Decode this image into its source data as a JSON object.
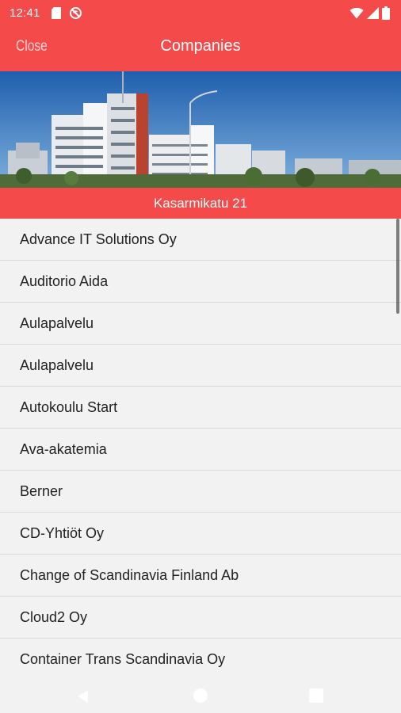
{
  "status_bar": {
    "time": "12:41",
    "icons": [
      "sd-card-icon",
      "no-sync-icon",
      "wifi-icon",
      "signal-icon",
      "battery-icon"
    ]
  },
  "app_bar": {
    "close_label": "Close",
    "title": "Companies"
  },
  "hero": {
    "image_name": "building-photo"
  },
  "address": "Kasarmikatu 21",
  "companies": [
    "Advance IT Solutions Oy",
    "Auditorio Aida",
    "Aulapalvelu",
    "Aulapalvelu",
    "Autokoulu Start",
    "Ava-akatemia",
    "Berner",
    "CD-Yhtiöt Oy",
    "Change of Scandinavia Finland Ab",
    "Cloud2 Oy",
    "Container Trans Scandinavia Oy"
  ],
  "colors": {
    "accent": "#f44a4a",
    "background": "#f2f2f2",
    "text": "#222222",
    "divider": "#d8d8d8"
  }
}
